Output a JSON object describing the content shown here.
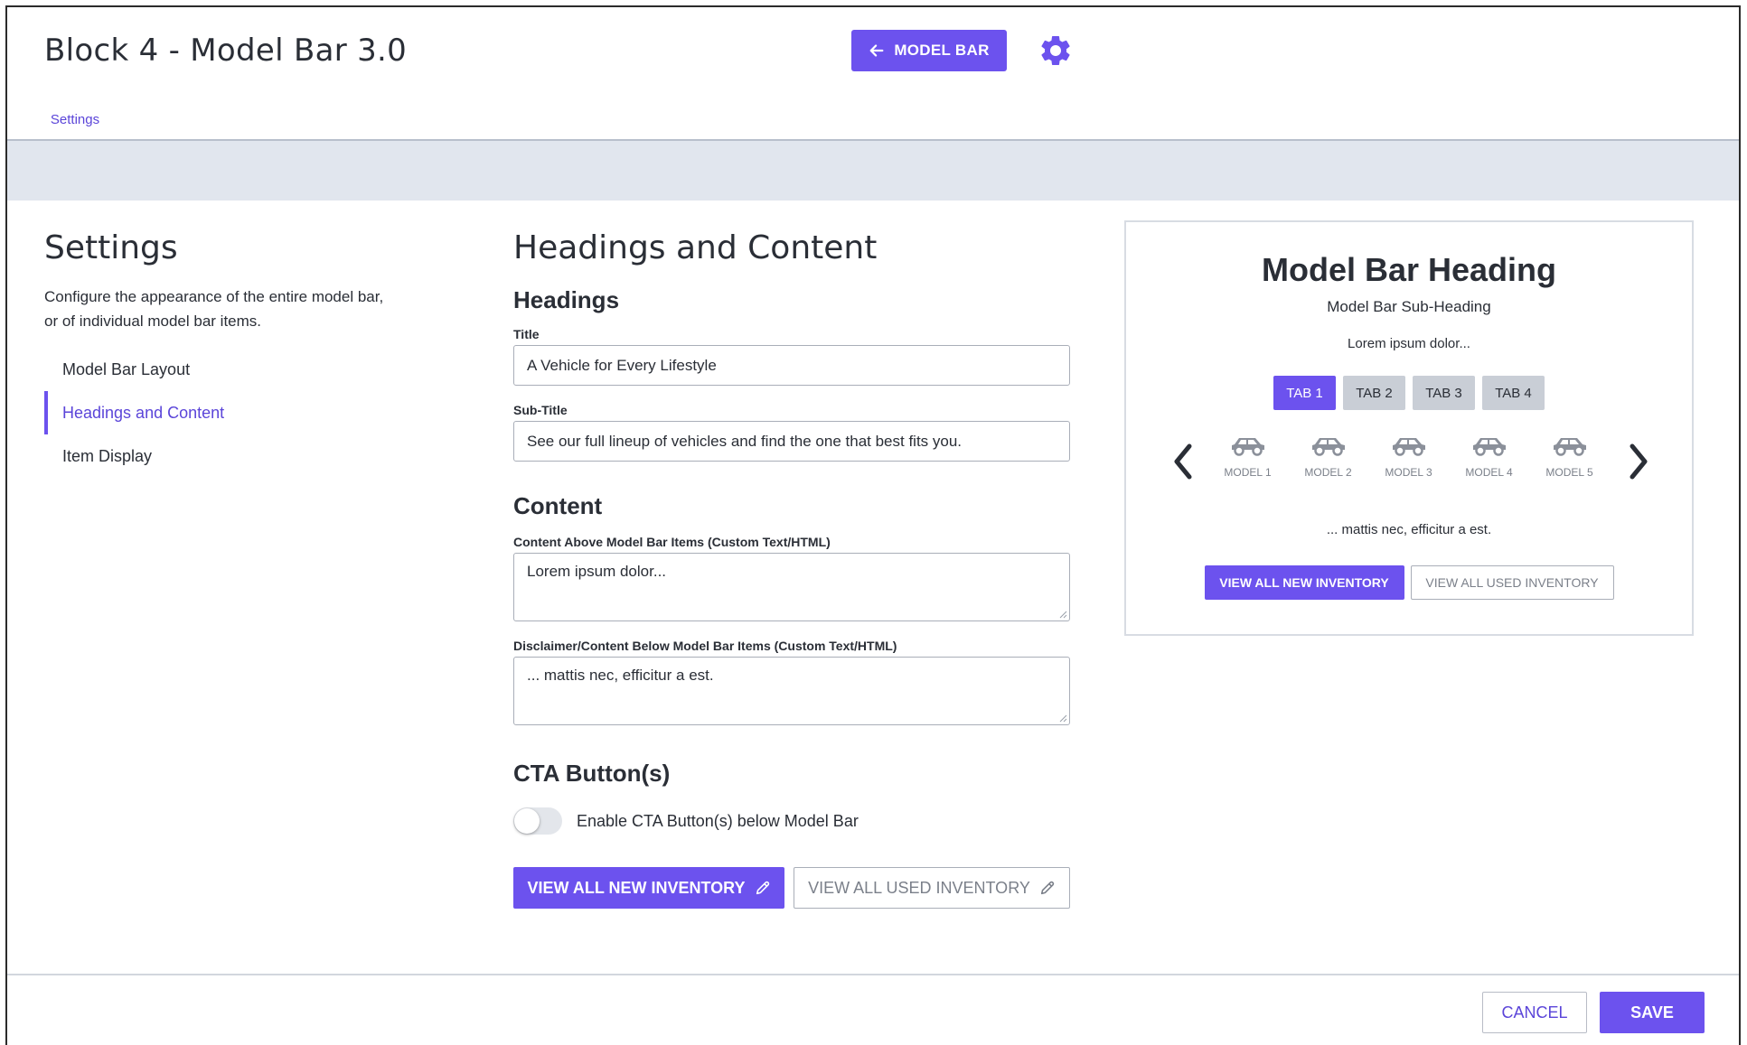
{
  "header": {
    "title": "Block 4 - Model Bar 3.0",
    "back_button_label": "MODEL BAR",
    "settings_icon": "gear-icon",
    "tab_label": "Settings"
  },
  "settings_panel": {
    "title": "Settings",
    "description": "Configure the appearance of the entire model bar, or of individual model bar items.",
    "nav": [
      {
        "label": "Model Bar Layout",
        "active": false
      },
      {
        "label": "Headings and Content",
        "active": true
      },
      {
        "label": "Item Display",
        "active": false
      }
    ]
  },
  "form": {
    "title": "Headings and Content",
    "headings_section": "Headings",
    "title_label": "Title",
    "title_value": "A Vehicle for Every Lifestyle",
    "subtitle_label": "Sub-Title",
    "subtitle_value": "See our full lineup of vehicles and find the one that best fits you.",
    "content_section": "Content",
    "content_above_label": "Content Above Model Bar Items (Custom Text/HTML)",
    "content_above_value": "Lorem ipsum dolor...",
    "disclaimer_label": "Disclaimer/Content Below Model Bar Items (Custom Text/HTML)",
    "disclaimer_value": "... mattis nec, efficitur a est.",
    "cta_section": "CTA Button(s)",
    "cta_toggle_label": "Enable CTA Button(s) below Model Bar",
    "cta_toggle_on": false,
    "cta_new_label": "VIEW ALL NEW INVENTORY",
    "cta_used_label": "VIEW ALL USED INVENTORY"
  },
  "preview": {
    "heading": "Model Bar Heading",
    "sub_heading": "Model Bar Sub-Heading",
    "content_above": "Lorem ipsum dolor...",
    "tabs": [
      "TAB 1",
      "TAB 2",
      "TAB 3",
      "TAB 4"
    ],
    "active_tab": 0,
    "models": [
      "MODEL 1",
      "MODEL 2",
      "MODEL 3",
      "MODEL 4",
      "MODEL 5"
    ],
    "content_below": "... mattis nec, efficitur a est.",
    "cta_new": "VIEW ALL NEW INVENTORY",
    "cta_used": "VIEW ALL USED INVENTORY"
  },
  "footer": {
    "cancel_label": "CANCEL",
    "save_label": "SAVE"
  },
  "colors": {
    "accent": "#6c52ee",
    "band": "#e1e6ee",
    "muted_text": "#7b808a"
  }
}
